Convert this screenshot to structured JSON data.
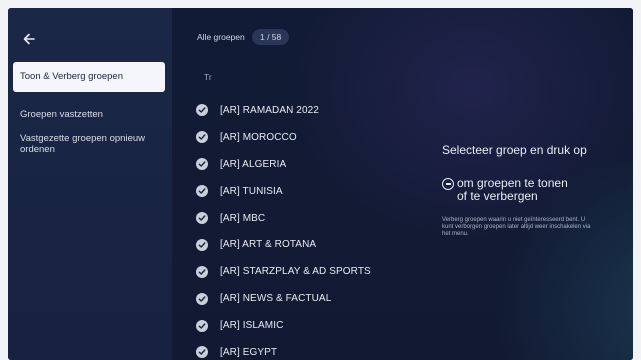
{
  "sidebar": {
    "back_icon": "arrow-left-icon",
    "items": [
      {
        "label": "Toon & Verberg groepen",
        "active": true
      },
      {
        "label": "Groepen vastzetten",
        "active": false
      },
      {
        "label": "Vastgezette groepen opnieuw ordenen",
        "active": false
      }
    ]
  },
  "header": {
    "all_groups_label": "Alle groepen",
    "count": "1 / 58"
  },
  "search": {
    "placeholder": "Tr"
  },
  "groups": [
    "[AR] RAMADAN 2022",
    "[AR] MOROCCO",
    "[AR] ALGERIA",
    "[AR] TUNISIA",
    "[AR] MBC",
    "[AR] ART & ROTANA",
    "[AR] STARZPLAY & AD SPORTS",
    "[AR] NEWS & FACTUAL",
    "[AR] ISLAMIC",
    "[AR] EGYPT"
  ],
  "info": {
    "title": "Selecteer groep en druk op",
    "line2": "om groepen te tonen\nof te verbergen",
    "ok_icon": "ok-button-icon",
    "subtitle": "Verberg groepen waarin u niet geïnteresseerd bent. U kunt verborgen groepen later altijd weer inschakelen via het menu."
  },
  "colors": {
    "background": "#121b35",
    "sidebar": "#1a2746",
    "active_item_bg": "#f4f6fb",
    "check_bg": "#c9cfdb"
  }
}
